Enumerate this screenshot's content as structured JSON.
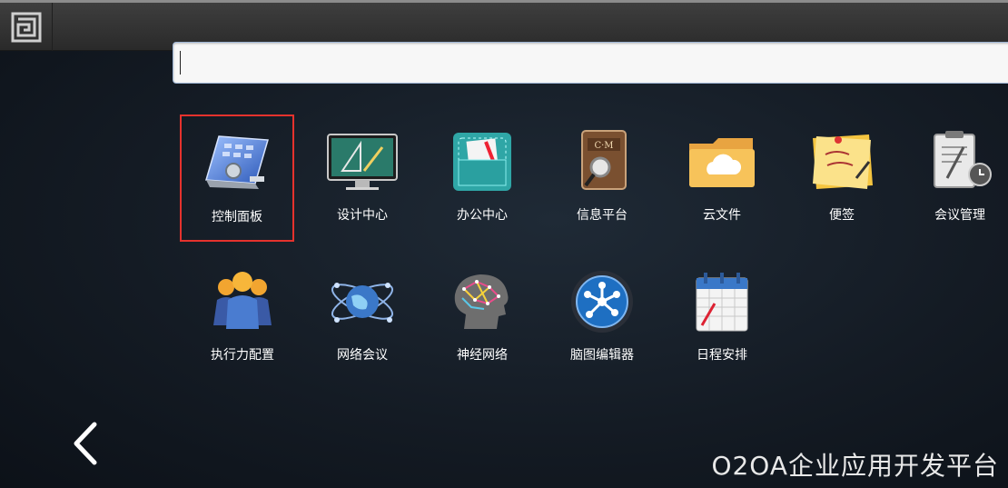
{
  "search": {
    "value": "",
    "placeholder": ""
  },
  "apps_row1": [
    {
      "label": "控制面板",
      "icon": "control-panel-icon"
    },
    {
      "label": "设计中心",
      "icon": "design-center-icon"
    },
    {
      "label": "办公中心",
      "icon": "office-center-icon"
    },
    {
      "label": "信息平台",
      "icon": "info-platform-icon"
    },
    {
      "label": "云文件",
      "icon": "cloud-file-icon"
    },
    {
      "label": "便签",
      "icon": "sticky-note-icon"
    },
    {
      "label": "会议管理",
      "icon": "meeting-management-icon"
    }
  ],
  "apps_row2": [
    {
      "label": "执行力配置",
      "icon": "execution-config-icon"
    },
    {
      "label": "网络会议",
      "icon": "network-meeting-icon"
    },
    {
      "label": "神经网络",
      "icon": "neural-network-icon"
    },
    {
      "label": "脑图编辑器",
      "icon": "mindmap-editor-icon"
    },
    {
      "label": "日程安排",
      "icon": "schedule-icon"
    }
  ],
  "brand": "O2OA企业应用开发平台",
  "colors": {
    "selection": "#e5322d",
    "background": "#141b24",
    "topbar": "#333333"
  }
}
